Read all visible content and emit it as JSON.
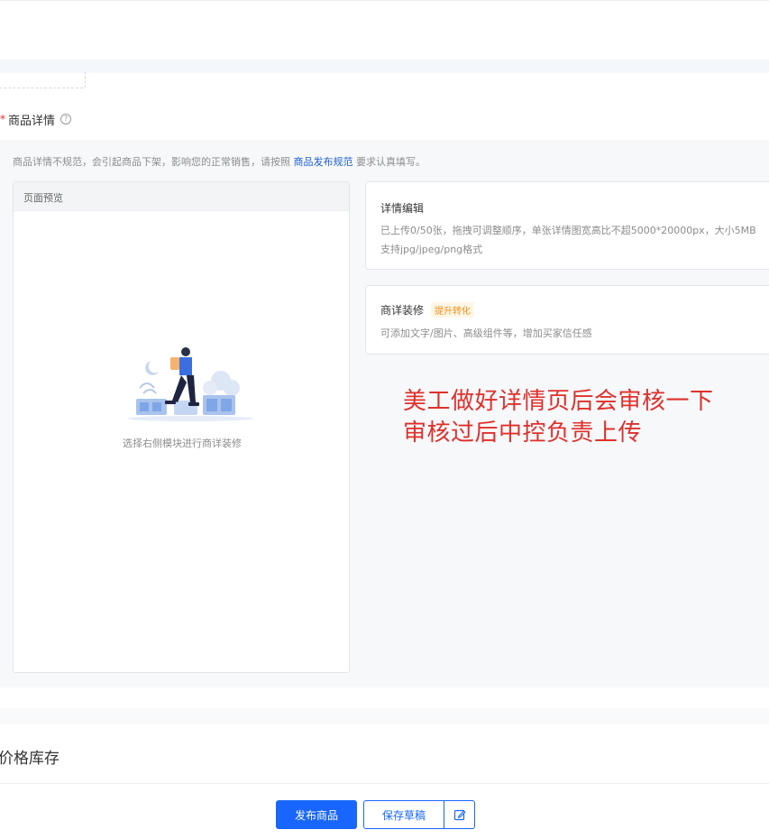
{
  "section": {
    "required_mark": "*",
    "title": "商品详情",
    "help_icon": "question-circle-icon"
  },
  "notice": {
    "prefix": "商品详情不规范，会引起商品下架，影响您的正常销售，请按照",
    "link": "商品发布规范",
    "suffix": "要求认真填写。"
  },
  "preview": {
    "header": "页面预览",
    "empty_text": "选择右侧模块进行商详装修"
  },
  "detail_edit": {
    "title": "详情编辑",
    "desc_line1": "已上传0/50张，拖拽可调整顺序，单张详情图宽高比不超5000*20000px，大小5MB",
    "desc_line2": "支持jpg/jpeg/png格式"
  },
  "detail_decor": {
    "title": "商详装修",
    "tag": "提升转化",
    "desc": "可添加文字/图片、高级组件等，增加买家信任感"
  },
  "annotation": {
    "line1": "美工做好详情页后会审核一下",
    "line2": "审核过后中控负责上传"
  },
  "price_section": {
    "title": "价格库存"
  },
  "footer": {
    "publish_label": "发布商品",
    "draft_label": "保存草稿",
    "edit_icon": "edit-icon"
  },
  "colors": {
    "primary": "#1966ff",
    "annotation": "#e0302b",
    "tag_text": "#fa8c16",
    "required": "#f5222d"
  }
}
